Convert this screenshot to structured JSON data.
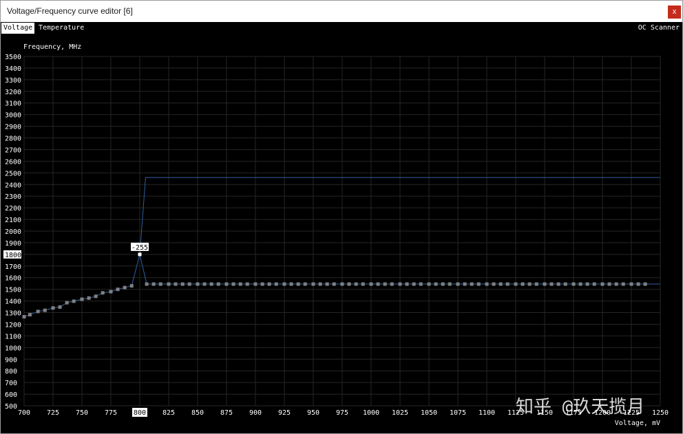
{
  "window": {
    "title": "Voltage/Frequency curve editor [6]",
    "close_label": "x"
  },
  "tabs": [
    {
      "label": "Voltage",
      "active": true
    },
    {
      "label": "Temperature",
      "active": false
    }
  ],
  "oc_scanner_label": "OC Scanner",
  "watermark": "知乎 @玖天揽月",
  "colors": {
    "background": "#000000",
    "grid": "#262626",
    "curve_line": "#2f62a3",
    "points": "#808080",
    "selected_point": "#ffffff",
    "axis_text": "#ffffff",
    "close_button": "#c42b1c"
  },
  "chart_data": {
    "type": "line",
    "ylabel": "Frequency, MHz",
    "xlabel": "Voltage, mV",
    "xlim": [
      700,
      1250
    ],
    "ylim": [
      500,
      3500
    ],
    "x_ticks": [
      700,
      725,
      750,
      775,
      800,
      825,
      850,
      875,
      900,
      925,
      950,
      975,
      1000,
      1025,
      1050,
      1075,
      1100,
      1125,
      1150,
      1175,
      1200,
      1225,
      1250
    ],
    "y_ticks": [
      500,
      600,
      700,
      800,
      900,
      1000,
      1100,
      1200,
      1300,
      1400,
      1500,
      1600,
      1700,
      1800,
      1900,
      2000,
      2100,
      2200,
      2300,
      2400,
      2500,
      2600,
      2700,
      2800,
      2900,
      3000,
      3100,
      3200,
      3300,
      3400,
      3500
    ],
    "grid": true,
    "selected_point": {
      "x": 800,
      "y": 1800,
      "offset_label": "-255"
    },
    "highlighted_x_tick": 800,
    "highlighted_y_tick": 1800,
    "series": [
      {
        "style": "points",
        "x": [
          700,
          705,
          712,
          718,
          725,
          731,
          737,
          743,
          750,
          756,
          762,
          768,
          775,
          781,
          787,
          793,
          800,
          806,
          812,
          818,
          825,
          831,
          837,
          843,
          850,
          856,
          862,
          868,
          875,
          881,
          887,
          893,
          900,
          906,
          912,
          918,
          925,
          931,
          937,
          943,
          950,
          956,
          962,
          968,
          975,
          981,
          987,
          993,
          1000,
          1006,
          1012,
          1018,
          1025,
          1031,
          1037,
          1043,
          1050,
          1056,
          1062,
          1068,
          1075,
          1081,
          1087,
          1093,
          1100,
          1106,
          1112,
          1118,
          1125,
          1131,
          1137,
          1143,
          1150,
          1156,
          1162,
          1168,
          1175,
          1181,
          1187,
          1193,
          1200,
          1206,
          1212,
          1218,
          1225,
          1231,
          1237,
          1243,
          1250
        ],
        "y": [
          1265,
          1282,
          1310,
          1320,
          1340,
          1348,
          1385,
          1398,
          1415,
          1425,
          1440,
          1470,
          1480,
          1500,
          1515,
          1530,
          1800,
          1545,
          1545,
          1545,
          1545,
          1545,
          1545,
          1545,
          1545,
          1545,
          1545,
          1545,
          1545,
          1545,
          1545,
          1545,
          1545,
          1545,
          1545,
          1545,
          1545,
          1545,
          1545,
          1545,
          1545,
          1545,
          1545,
          1545,
          1545,
          1545,
          1545,
          1545,
          1545,
          1545,
          1545,
          1545,
          1545,
          1545,
          1545,
          1545,
          1545,
          1545,
          1545,
          1545,
          1545,
          1545,
          1545,
          1545,
          1545,
          1545,
          1545,
          1545,
          1545,
          1545,
          1545,
          1545,
          1545,
          1545,
          1545,
          1545,
          1545,
          1545,
          1545,
          1545,
          1545,
          1545,
          1545,
          1545,
          1545,
          1545,
          1545,
          1545,
          1545
        ],
        "point_end_x": 1240
      },
      {
        "style": "line",
        "x": [
          805,
          1250
        ],
        "y": [
          2460,
          2460
        ]
      }
    ]
  }
}
